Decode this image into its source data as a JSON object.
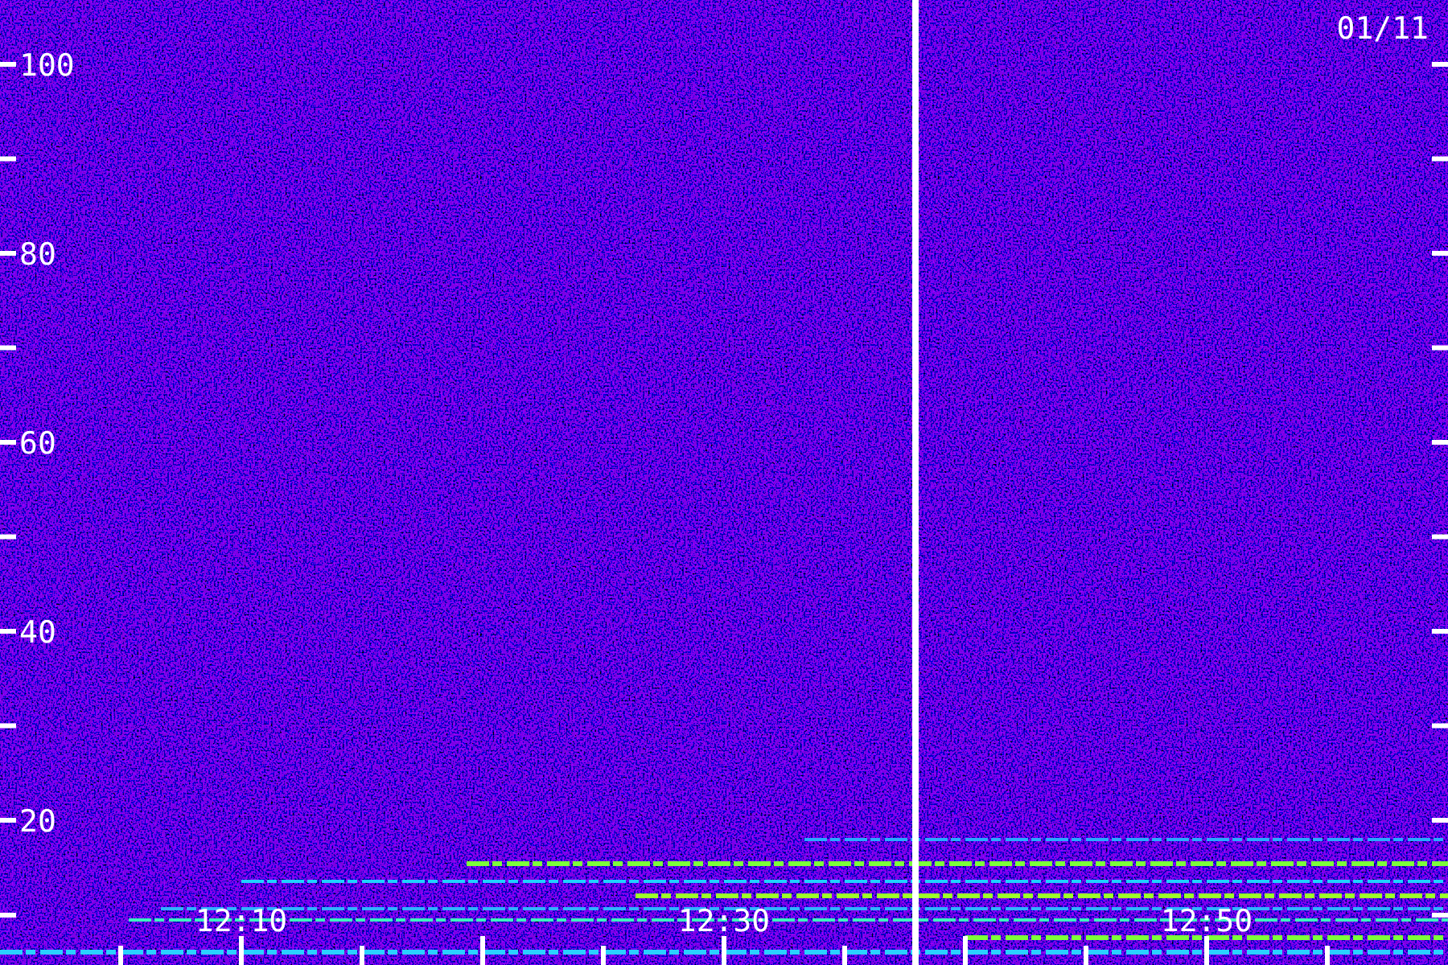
{
  "spectrogram": {
    "date": "01/11",
    "y_axis_labels": [
      "100",
      "80",
      "60",
      "40",
      "20"
    ],
    "x_axis_labels": [
      "12:10",
      "12:30",
      "12:50"
    ]
  }
}
